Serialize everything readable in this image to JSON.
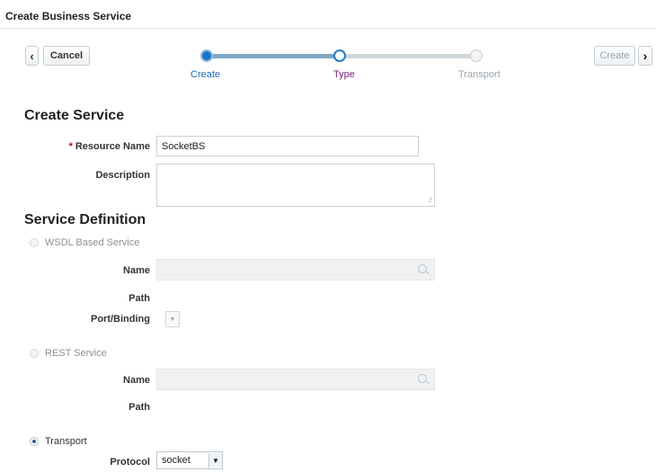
{
  "window": {
    "title": "Create Business Service",
    "close_symbol": "×"
  },
  "nav": {
    "prev_symbol": "‹",
    "cancel_label": "Cancel",
    "create_label": "Create",
    "next_symbol": "›"
  },
  "train": {
    "steps": [
      {
        "label": "Create",
        "state": "visited"
      },
      {
        "label": "Type",
        "state": "current"
      },
      {
        "label": "Transport",
        "state": "disabled"
      }
    ]
  },
  "create_service": {
    "heading": "Create Service",
    "required_marker": "*",
    "resource_name_label": "Resource Name",
    "resource_name_value": "SocketBS",
    "description_label": "Description",
    "description_value": ""
  },
  "service_definition": {
    "heading": "Service Definition",
    "wsdl": {
      "label": "WSDL Based Service",
      "selected": false,
      "name_label": "Name",
      "name_value": "",
      "path_label": "Path",
      "port_binding_label": "Port/Binding"
    },
    "rest": {
      "label": "REST Service",
      "selected": false,
      "name_label": "Name",
      "name_value": "",
      "path_label": "Path"
    },
    "transport": {
      "label": "Transport",
      "selected": true,
      "protocol_label": "Protocol",
      "protocol_value": "socket"
    }
  },
  "colors": {
    "accent": "#1a74c8",
    "current_step": "#7a1e7e",
    "disabled_text": "#9aa3aa"
  }
}
